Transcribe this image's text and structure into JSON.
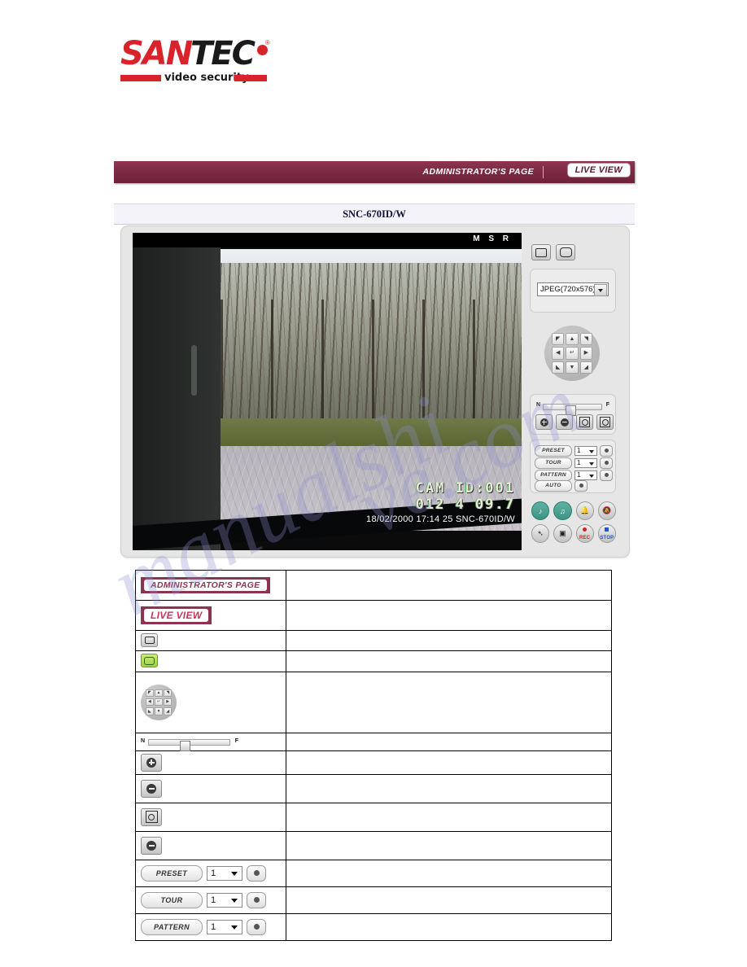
{
  "brand": {
    "name_part1": "SAN",
    "name_part2": "TEC",
    "registered": "®",
    "tagline": "video security"
  },
  "header": {
    "admin_label": "ADMINISTRATOR'S PAGE",
    "live_label": "LIVE VIEW",
    "accent_color": "#7c2b44"
  },
  "model_title": "SNC-670ID/W",
  "video": {
    "status_indicators": "M S R",
    "osd_line1": "CAM ID:001",
    "osd_line2": "012 4 09.7",
    "osd_line3": "18/02/2000 17:14 25 SNC-670ID/W"
  },
  "controls": {
    "view_single_icon": "single-view-icon",
    "view_full_icon": "full-view-icon",
    "format_value": "JPEG(720x576)",
    "dpad_keys": [
      "◤",
      "▲",
      "◥",
      "◀",
      "↵",
      "▶",
      "◣",
      "▼",
      "◢"
    ],
    "focus_near": "N",
    "focus_far": "F",
    "zoom_in_icon": "zoom-in-icon",
    "zoom_out_icon": "zoom-out-icon",
    "iris_open_icon": "iris-open-icon",
    "iris_close_icon": "iris-close-icon",
    "preset_label": "PRESET",
    "preset_value": "1",
    "tour_label": "TOUR",
    "tour_value": "1",
    "pattern_label": "PATTERN",
    "pattern_value": "1",
    "auto_label": "AUTO",
    "rec_label": "REC",
    "stop_label": "STOP"
  },
  "table": {
    "rows": [
      {
        "kind": "tag-admin",
        "label": "ADMINISTRATOR'S PAGE",
        "desc": ""
      },
      {
        "kind": "tag-live",
        "label": "LIVE VIEW",
        "desc": ""
      },
      {
        "kind": "icon-single",
        "label": "",
        "desc": ""
      },
      {
        "kind": "icon-full",
        "label": "",
        "desc": ""
      },
      {
        "kind": "dpad",
        "label": "",
        "desc": ""
      },
      {
        "kind": "slider",
        "label": "",
        "desc": ""
      },
      {
        "kind": "zoom-in",
        "label": "",
        "desc": ""
      },
      {
        "kind": "zoom-out",
        "label": "",
        "desc": ""
      },
      {
        "kind": "iris-open",
        "label": "",
        "desc": ""
      },
      {
        "kind": "iris-close",
        "label": "",
        "desc": ""
      },
      {
        "kind": "preset",
        "label": "PRESET",
        "value": "1",
        "desc": ""
      },
      {
        "kind": "tour",
        "label": "TOUR",
        "value": "1",
        "desc": ""
      },
      {
        "kind": "pattern",
        "label": "PATTERN",
        "value": "1",
        "desc": ""
      }
    ]
  },
  "watermark": {
    "text1": "manualshi",
    "text2": "ve.com"
  }
}
